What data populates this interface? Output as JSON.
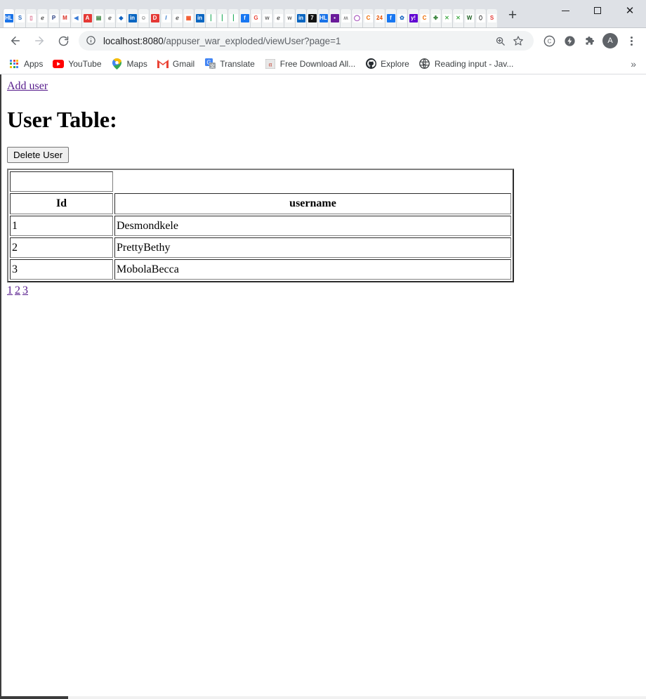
{
  "window": {
    "minimize_label": "Minimize",
    "maximize_label": "Maximize",
    "close_label": "Close",
    "new_tab_label": "+"
  },
  "tabs": [
    {
      "favicon": "hl",
      "bg": "#1a73e8",
      "fg": "#ffffff",
      "text": "HL"
    },
    {
      "favicon": "s-blue",
      "bg": "#ffffff",
      "fg": "#2d6ebf",
      "text": "S"
    },
    {
      "favicon": "pink-doc",
      "bg": "#ffffff",
      "fg": "#d96a8a",
      "text": "▯"
    },
    {
      "favicon": "gray-e",
      "bg": "#ffffff",
      "fg": "#555555",
      "text": "ℯ"
    },
    {
      "favicon": "paypal",
      "bg": "#ffffff",
      "fg": "#253b80",
      "text": "P"
    },
    {
      "favicon": "gmail",
      "bg": "#ffffff",
      "fg": "#d93025",
      "text": "M"
    },
    {
      "favicon": "blue-play",
      "bg": "#ffffff",
      "fg": "#3a7bd5",
      "text": "◀"
    },
    {
      "favicon": "red-a",
      "bg": "#e53935",
      "fg": "#ffffff",
      "text": "A"
    },
    {
      "favicon": "green-note",
      "bg": "#ffffff",
      "fg": "#2e7d32",
      "text": "▤"
    },
    {
      "favicon": "gray-e2",
      "bg": "#ffffff",
      "fg": "#555555",
      "text": "ℯ"
    },
    {
      "favicon": "blue-diamond",
      "bg": "#ffffff",
      "fg": "#1565c0",
      "text": "◆"
    },
    {
      "favicon": "linkedin",
      "bg": "#0a66c2",
      "fg": "#ffffff",
      "text": "in"
    },
    {
      "favicon": "avatar",
      "bg": "#ffffff",
      "fg": "#444444",
      "text": "☺"
    },
    {
      "favicon": "red-d",
      "bg": "#e53935",
      "fg": "#ffffff",
      "text": "D"
    },
    {
      "favicon": "slash",
      "bg": "#ffffff",
      "fg": "#1565c0",
      "text": "/"
    },
    {
      "favicon": "gray-e3",
      "bg": "#ffffff",
      "fg": "#555555",
      "text": "ℯ"
    },
    {
      "favicon": "microsoft",
      "bg": "#ffffff",
      "fg": "#f25022",
      "text": "▦"
    },
    {
      "favicon": "linkedin2",
      "bg": "#0a66c2",
      "fg": "#ffffff",
      "text": "in"
    },
    {
      "favicon": "green-bar1",
      "bg": "#ffffff",
      "fg": "#27ae60",
      "text": "⎮"
    },
    {
      "favicon": "green-bar2",
      "bg": "#ffffff",
      "fg": "#27ae60",
      "text": "⎮"
    },
    {
      "favicon": "green-bar3",
      "bg": "#ffffff",
      "fg": "#27ae60",
      "text": "⎮"
    },
    {
      "favicon": "facebook",
      "bg": "#1877f2",
      "fg": "#ffffff",
      "text": "f"
    },
    {
      "favicon": "google",
      "bg": "#ffffff",
      "fg": "#ea4335",
      "text": "G"
    },
    {
      "favicon": "w-gray1",
      "bg": "#ffffff",
      "fg": "#666666",
      "text": "w"
    },
    {
      "favicon": "gray-e4",
      "bg": "#ffffff",
      "fg": "#555555",
      "text": "ℯ"
    },
    {
      "favicon": "w-gray2",
      "bg": "#ffffff",
      "fg": "#666666",
      "text": "w"
    },
    {
      "favicon": "linkedin3",
      "bg": "#0a66c2",
      "fg": "#ffffff",
      "text": "in"
    },
    {
      "favicon": "black-7",
      "bg": "#111111",
      "fg": "#ffffff",
      "text": "7"
    },
    {
      "favicon": "hl2",
      "bg": "#1a73e8",
      "fg": "#ffffff",
      "text": "HL"
    },
    {
      "favicon": "purple-box",
      "bg": "#6a1b9a",
      "fg": "#ffffff",
      "text": "▪"
    },
    {
      "favicon": "wa-gray",
      "bg": "#ffffff",
      "fg": "#888888",
      "text": "ʍ"
    },
    {
      "favicon": "purple-ring",
      "bg": "#ffffff",
      "fg": "#8e24aa",
      "text": "◯"
    },
    {
      "favicon": "orange-c",
      "bg": "#ffffff",
      "fg": "#ef6c00",
      "text": "C"
    },
    {
      "favicon": "cal24",
      "bg": "#ffffff",
      "fg": "#e65100",
      "text": "24"
    },
    {
      "favicon": "facebook2",
      "bg": "#1877f2",
      "fg": "#ffffff",
      "text": "f"
    },
    {
      "favicon": "blue-gear",
      "bg": "#ffffff",
      "fg": "#1565c0",
      "text": "✿"
    },
    {
      "favicon": "yahoo",
      "bg": "#6001d2",
      "fg": "#ffffff",
      "text": "y!"
    },
    {
      "favicon": "orange-c2",
      "bg": "#ffffff",
      "fg": "#ef6c00",
      "text": "C"
    },
    {
      "favicon": "green-globe",
      "bg": "#ffffff",
      "fg": "#2e7d32",
      "text": "✤"
    },
    {
      "favicon": "x-green1",
      "bg": "#ffffff",
      "fg": "#4caf50",
      "text": "✕"
    },
    {
      "favicon": "x-green2",
      "bg": "#ffffff",
      "fg": "#4caf50",
      "text": "✕"
    },
    {
      "favicon": "word-w",
      "bg": "#ffffff",
      "fg": "#1b5e20",
      "text": "W"
    },
    {
      "favicon": "dark-shield",
      "bg": "#ffffff",
      "fg": "#222222",
      "text": "⬯"
    },
    {
      "favicon": "red-s",
      "bg": "#ffffff",
      "fg": "#e53935",
      "text": "S"
    }
  ],
  "nav": {
    "back_label": "Back",
    "forward_label": "Forward",
    "reload_label": "Reload",
    "url_prefix": "localhost:8080",
    "url_suffix": "/appuser_war_exploded/viewUser?page=1",
    "url_full": "localhost:8080/appuser_war_exploded/viewUser?page=1",
    "site_info_label": "View site information",
    "zoom_label": "Zoom",
    "bookmark_label": "Bookmark this tab",
    "profile_initial": "A",
    "menu_label": "Customize and control Google Chrome"
  },
  "bookmarks": {
    "items": [
      {
        "label": "Apps",
        "icon": "apps-grid-icon"
      },
      {
        "label": "YouTube",
        "icon": "youtube-icon",
        "glyph": "▶",
        "color": "#ff0000"
      },
      {
        "label": "Maps",
        "icon": "maps-icon",
        "glyph": "◉",
        "color": "#34a853"
      },
      {
        "label": "Gmail",
        "icon": "gmail-icon",
        "glyph": "M",
        "color": "#ea4335"
      },
      {
        "label": "Translate",
        "icon": "translate-icon",
        "glyph": "G",
        "color": "#4285f4"
      },
      {
        "label": "Free Download All...",
        "icon": "free-download-icon",
        "glyph": "α",
        "color": "#c0392b"
      },
      {
        "label": "Explore",
        "icon": "github-icon",
        "glyph": "◑",
        "color": "#24292e"
      },
      {
        "label": "Reading input - Jav...",
        "icon": "globe-icon",
        "glyph": "◕",
        "color": "#5f6368"
      }
    ],
    "overflow_label": "»"
  },
  "page": {
    "add_user_link": "Add user",
    "title": "User Table:",
    "delete_button": "Delete User",
    "table": {
      "headers": {
        "select": "",
        "id": "Id",
        "username": "username"
      },
      "rows": [
        {
          "selected": false,
          "id": "1",
          "username": "Desmondkele"
        },
        {
          "selected": false,
          "id": "2",
          "username": "PrettyBethy"
        },
        {
          "selected": false,
          "id": "3",
          "username": "MobolaBecca"
        }
      ]
    },
    "pagination": [
      "1",
      "2",
      "3"
    ]
  },
  "colors": {
    "link": "#551a8b",
    "tabstrip_bg": "#dee1e6",
    "omnibox_bg": "#f1f3f4",
    "text": "#202124"
  }
}
